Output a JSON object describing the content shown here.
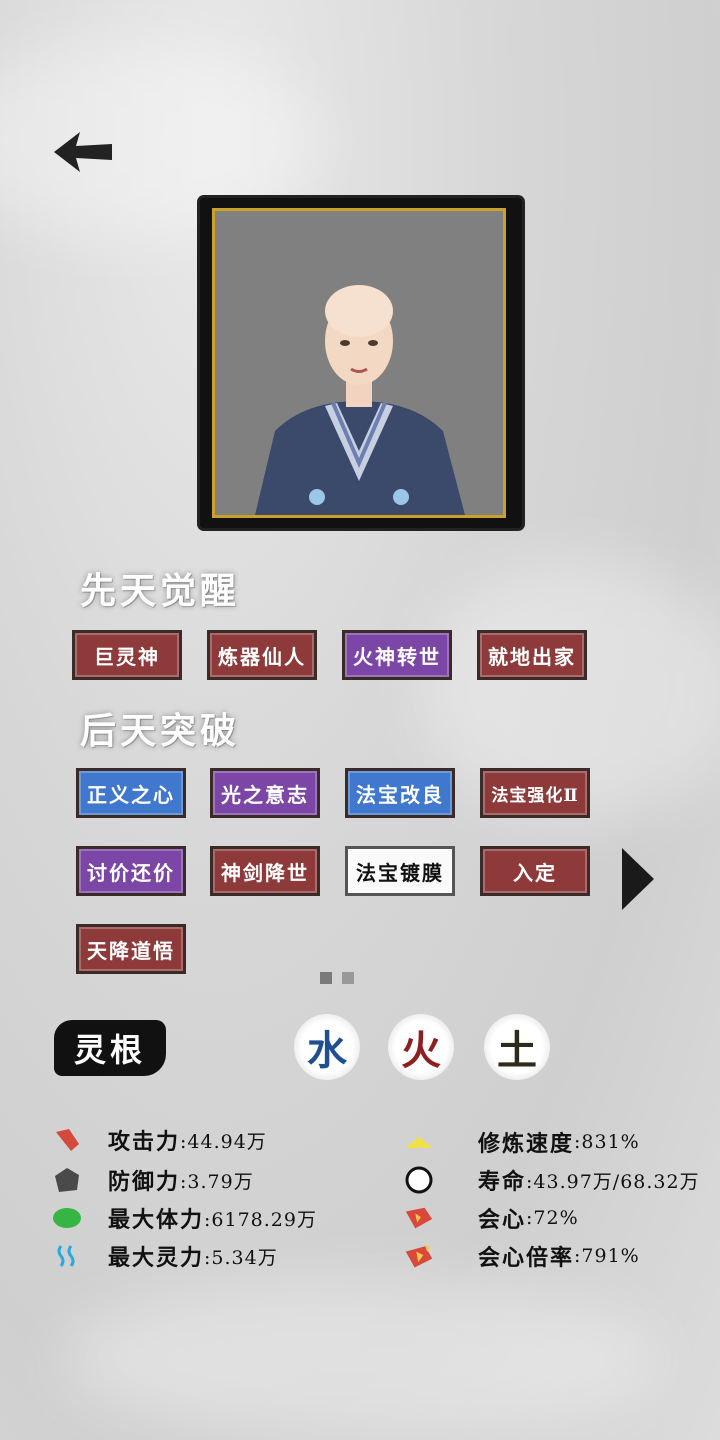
{
  "portrait": {
    "alt": "character-portrait"
  },
  "innate": {
    "title": "先天觉醒",
    "tags": [
      "巨灵神",
      "炼器仙人",
      "火神转世",
      "就地出家"
    ]
  },
  "acquired": {
    "title": "后天突破",
    "tags": [
      "正义之心",
      "光之意志",
      "法宝改良",
      "法宝强化Ⅱ",
      "讨价还价",
      "神剑降世",
      "法宝镀膜",
      "入定",
      "天降道悟"
    ]
  },
  "spirit_root": {
    "label": "灵根",
    "elements": [
      "水",
      "火",
      "土"
    ]
  },
  "stats_left": [
    {
      "name": "攻击力",
      "value": ":44.94万"
    },
    {
      "name": "防御力",
      "value": ":3.79万"
    },
    {
      "name": "最大体力",
      "value": ":6178.29万"
    },
    {
      "name": "最大灵力",
      "value": ":5.34万"
    }
  ],
  "stats_right": [
    {
      "name": "修炼速度",
      "value": ":831%"
    },
    {
      "name": "寿命",
      "value": ":43.97万/68.32万"
    },
    {
      "name": "会心",
      "value": ":72%"
    },
    {
      "name": "会心倍率",
      "value": ":791%"
    }
  ],
  "colors": {
    "tag_red": "#8e3a3a",
    "tag_purple": "#7b46a6",
    "tag_blue": "#3f78cc",
    "water": "#1f4f8f",
    "fire": "#8e1f1f",
    "earth": "#2e2a1c"
  },
  "icons": [
    "back-arrow-icon",
    "next-arrow-icon",
    "attack-icon",
    "defense-icon",
    "health-icon",
    "mana-icon",
    "speed-icon",
    "lifespan-icon",
    "crit-icon",
    "crit-multiplier-icon"
  ]
}
